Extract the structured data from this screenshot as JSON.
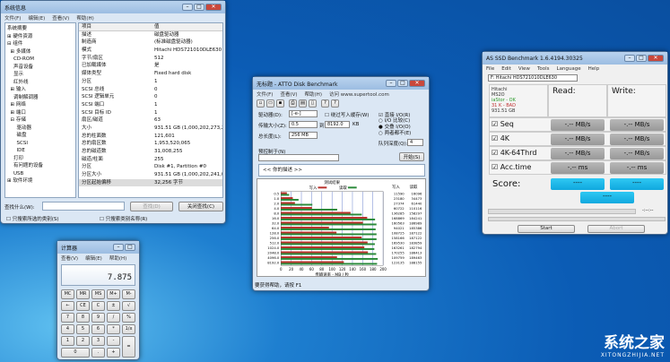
{
  "sysinfo": {
    "title": "系统信息",
    "menu": [
      "文件(F)",
      "编辑(E)",
      "查看(V)",
      "帮助(H)"
    ],
    "tree": [
      "系统摘要",
      "⊞ 硬件资源",
      "⊟ 组件",
      "  ⊞ 多媒体",
      "    CD-ROM",
      "    声音设备",
      "    显示",
      "    红外线",
      "  ⊞ 输入",
      "    调制解调器",
      "  ⊞ 网络",
      "  ⊞ 端口",
      "  ⊟ 存储",
      "      驱动器",
      "      磁盘",
      "      SCSI",
      "      IDE",
      "    打印",
      "    有问题的设备",
      "    USB",
      "⊞ 软件环境"
    ],
    "columns": [
      "项目",
      "值"
    ],
    "rows": [
      [
        "描述",
        "磁盘驱动器"
      ],
      [
        "制造商",
        "(标准磁盘驱动器)"
      ],
      [
        "模式",
        "Hitachi HDS721010DLE630"
      ],
      [
        "字节/扇区",
        "512"
      ],
      [
        "已加载媒体",
        "是"
      ],
      [
        "媒体类型",
        "Fixed hard disk"
      ],
      [
        "分区",
        "1"
      ],
      [
        "SCSI 总线",
        "0"
      ],
      [
        "SCSI 逻辑单元",
        "0"
      ],
      [
        "SCSI 端口",
        "1"
      ],
      [
        "SCSI 目标 ID",
        "1"
      ],
      [
        "扇区/磁道",
        "63"
      ],
      [
        "大小",
        "931.51 GB (1,000,202,273,280"
      ],
      [
        "总的柱面数",
        "121,601"
      ],
      [
        "总的扇区数",
        "1,953,520,065"
      ],
      [
        "总的磁道数",
        "31,008,255"
      ],
      [
        "磁道/柱面",
        "255"
      ],
      [
        "分区",
        "Disk #1, Partition #0"
      ],
      [
        "分区大小",
        "931.51 GB (1,000,202,241,02"
      ],
      [
        "分区起始偏移",
        "32,256 字节"
      ]
    ],
    "find_label": "查找什么(W):",
    "find_button": "查找(D)",
    "close_find_button": "关闭查找(C)",
    "check1": "只搜索所选的类别(S)",
    "check2": "只搜索类别名称(R)"
  },
  "calc": {
    "title": "计算器",
    "menu": [
      "查看(V)",
      "编辑(E)",
      "帮助(H)"
    ],
    "display": "7.875",
    "keys": [
      "MC",
      "MR",
      "MS",
      "M+",
      "M-",
      "←",
      "CE",
      "C",
      "±",
      "√",
      "7",
      "8",
      "9",
      "/",
      "%",
      "4",
      "5",
      "6",
      "*",
      "1/x",
      "1",
      "2",
      "3",
      "-",
      "=",
      "0",
      ".",
      "+"
    ]
  },
  "atto": {
    "title": "无标题 - ATTO Disk Benchmark",
    "menu": [
      "文件(F)",
      "查看(V)",
      "帮助(H)",
      "访问 www.supertool.com"
    ],
    "drive_label": "驱动器(D):",
    "drive": "[-e-]",
    "size_label": "传输大小(Z):",
    "size_from": "0.5",
    "to": "到",
    "size_to": "8192.0",
    "kb": "KB",
    "length_label": "总长度(L):",
    "length": "256 MB",
    "bypass": "绕过写入缓存(W)",
    "direct": "直接 I/O(R)",
    "io_compare": "I/O 比较(C)",
    "overlap": "交叠 I/O(O)",
    "neither": "两者都不(E)",
    "queue_label": "队列深度(Q):",
    "queue": "4",
    "control_label": "预控制于(N)",
    "start": "开始(S)",
    "desc": "<< 你的描述 >>",
    "status": "要获得帮助，请按 F1"
  },
  "chart_data": {
    "type": "bar",
    "title": "测试结果",
    "legend": [
      "写入",
      "读取"
    ],
    "colors": [
      "#b8302a",
      "#2a8a3a"
    ],
    "categories": [
      "0.5",
      "1.0",
      "2.0",
      "4.0",
      "8.0",
      "16.0",
      "32.0",
      "64.0",
      "128.0",
      "256.0",
      "512.0",
      "1024.0",
      "2048.0",
      "4096.0",
      "8192.0"
    ],
    "series": [
      {
        "name": "写入",
        "values": [
          11590,
          23180,
          27374,
          60722,
          136285,
          168869,
          160563,
          94021,
          108725,
          158166,
          169530,
          163261,
          170255,
          109759,
          123135
        ]
      },
      {
        "name": "读取",
        "values": [
          16096,
          34473,
          61440,
          110116,
          158297,
          184241,
          186989,
          185386,
          187122,
          187122,
          183859,
          182794,
          186413,
          189463,
          188155
        ]
      }
    ],
    "xlabel": "传输速率 - MB / 秒",
    "xlim": [
      0,
      200
    ],
    "xticks": [
      "0",
      "20",
      "40",
      "60",
      "80",
      "100",
      "120",
      "140",
      "160",
      "180",
      "200"
    ],
    "col_write": "写入",
    "col_read": "读取"
  },
  "asssd": {
    "title": "AS SSD Benchmark 1.6.4194.30325",
    "menu": [
      "File",
      "Edit",
      "View",
      "Tools",
      "Language",
      "Help"
    ],
    "drive": "F: Hitachi HDS721010DLE630",
    "info": [
      "Hitachi",
      "MS2O",
      "iaStor - OK",
      "31 K - BAD",
      "931.51 GB"
    ],
    "read": "Read:",
    "write": "Write:",
    "tests": [
      "Seq",
      "4K",
      "4K-64Thrd",
      "Acc.time"
    ],
    "values": [
      "-.-- MB/s",
      "-.-- MB/s",
      "-.-- MB/s",
      "-.-- ms"
    ],
    "score": "Score:",
    "score_val": "----",
    "time": "-:--:--",
    "start": "Start",
    "abort": "Abort",
    "info_colors": [
      "#333",
      "#333",
      "#2a9a2a",
      "#c03030",
      "#333"
    ]
  },
  "watermark": {
    "name": "系统之家",
    "url": "XITONGZHIJIA.NET"
  }
}
